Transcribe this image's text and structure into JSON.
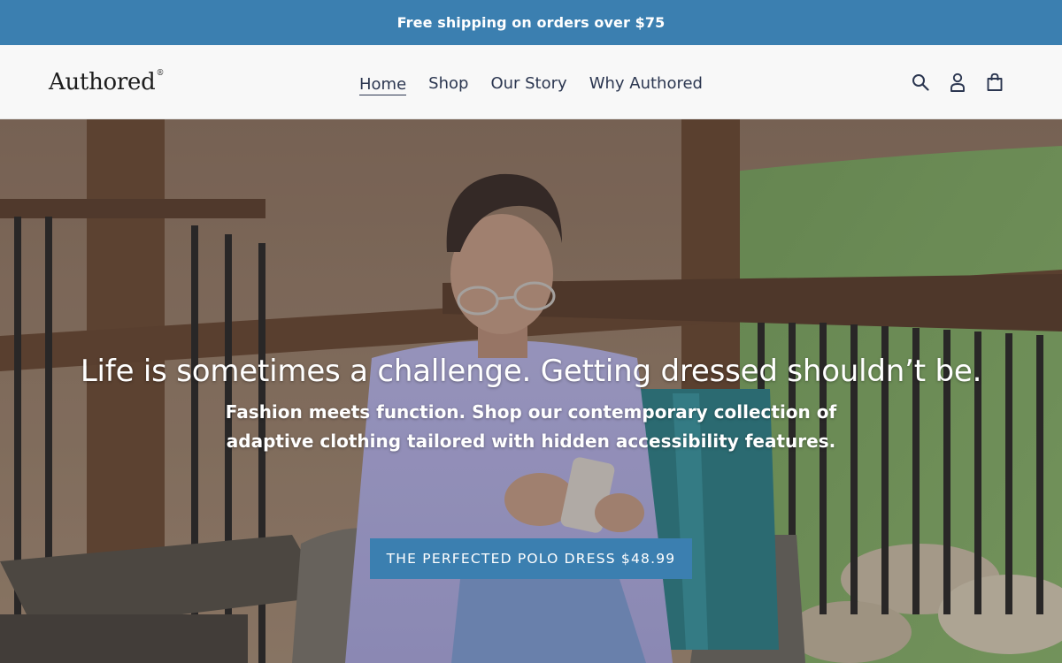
{
  "announcement": {
    "text": "Free shipping on orders over $75"
  },
  "header": {
    "logo": "Authored",
    "logo_mark": "®",
    "nav": [
      {
        "label": "Home",
        "active": true
      },
      {
        "label": "Shop",
        "active": false
      },
      {
        "label": "Our Story",
        "active": false
      },
      {
        "label": "Why Authored",
        "active": false
      }
    ],
    "icons": [
      "search-icon",
      "account-icon",
      "cart-icon"
    ]
  },
  "hero": {
    "title": "Life is sometimes a challenge. Getting dressed shouldn’t be.",
    "subtitle": "Fashion meets function. Shop our contemporary collection of adaptive clothing tailored with hidden accessibility features.",
    "cta": "THE PERFECTED POLO DRESS $48.99"
  },
  "colors": {
    "accent": "#3b7fb0",
    "nav_text": "#2b3650",
    "header_bg": "#f8f8f8"
  }
}
